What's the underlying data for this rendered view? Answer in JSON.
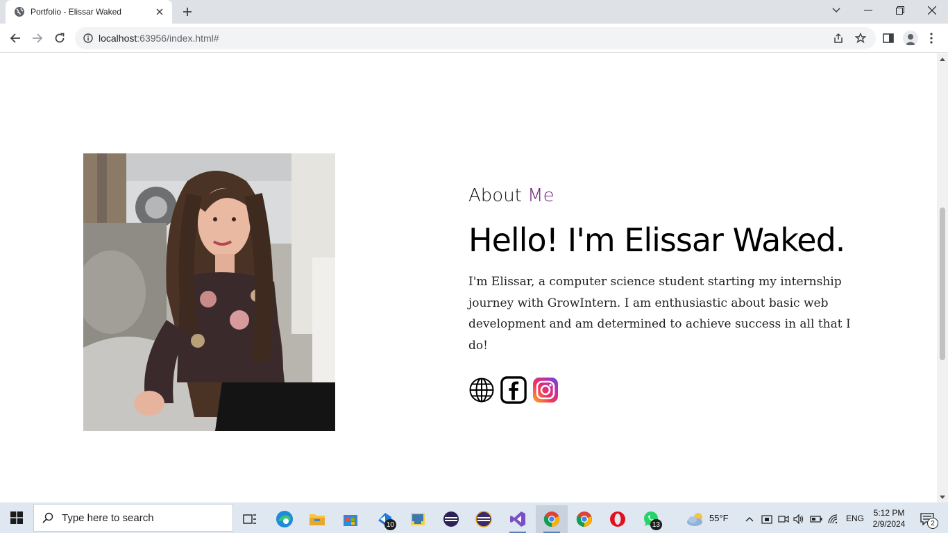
{
  "browser": {
    "tab_title": "Portfolio - Elissar Waked",
    "url_host": "localhost",
    "url_path": ":63956/index.html#"
  },
  "page": {
    "eyebrow_text": "About",
    "eyebrow_accent": "Me",
    "headline": "Hello! I'm Elissar Waked.",
    "bio": "I'm Elissar, a computer science student starting my internship journey with GrowIntern. I am enthusiastic about basic web development and am determined to achieve success in all that I do!",
    "accent_color": "#6a1b7a",
    "socials": [
      "globe-icon",
      "facebook-icon",
      "instagram-icon"
    ]
  },
  "taskbar": {
    "search_placeholder": "Type here to search",
    "badges": {
      "vscode": "10",
      "whatsapp": "13",
      "notifications": "2"
    },
    "weather": "55°F",
    "language": "ENG",
    "time": "5:12 PM",
    "date": "2/9/2024"
  }
}
